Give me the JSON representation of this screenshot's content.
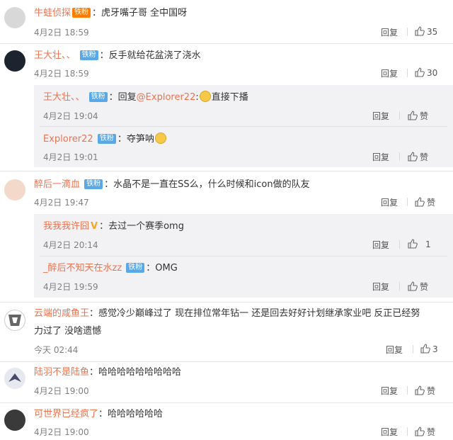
{
  "comments": [
    {
      "user": "牛蛙侦探",
      "badge": "铁粉",
      "text": "：虎牙嘴子哥  全中国呀",
      "time": "4月2日 18:59",
      "reply": "回复",
      "likes": "35"
    },
    {
      "user": "王大壮、、",
      "badge": "铁粉",
      "text": "：反手就给花盆浇了浇水",
      "time": "4月2日 18:59",
      "reply": "回复",
      "likes": "30",
      "replies": [
        {
          "user": "王大壮、、",
          "badge": "铁粉",
          "prefix": "：回复",
          "mention": "@Explorer22",
          "text": ":",
          "suffix": "直接下播",
          "time": "4月2日 19:04",
          "reply": "回复",
          "likes": "赞"
        },
        {
          "user": "Explorer22",
          "badge": "铁粉",
          "text": "：夺笋呐",
          "time": "4月2日 19:01",
          "reply": "回复",
          "likes": "赞"
        }
      ]
    },
    {
      "user": "醉后一滴血",
      "badge": "铁粉",
      "text": "：水晶不是一直在SS么，什么时候和icon做的队友",
      "time": "4月2日 19:47",
      "reply": "回复",
      "likes": "赞",
      "replies": [
        {
          "user": "我我我许囧",
          "text": "：去过一个赛季omg",
          "time": "4月2日 20:14",
          "reply": "回复",
          "likes": "1"
        },
        {
          "user": "_醉后不知天在水zz",
          "badge": "铁粉",
          "text": "：OMG",
          "time": "4月2日 19:59",
          "reply": "回复",
          "likes": "赞"
        }
      ]
    },
    {
      "user": "云端的咸鱼王",
      "text1": "：感觉冷少巅峰过了  现在排位常年钻一  还是回去好好计划继承家业吧  反正已经努",
      "text2": "力过了 没啥遗憾",
      "time": "今天 02:44",
      "reply": "回复",
      "likes": "3"
    },
    {
      "user": "陆羽不是陆鱼",
      "text": "：哈哈哈哈哈哈哈哈哈",
      "time": "4月2日 19:00",
      "reply": "回复",
      "likes": "赞"
    },
    {
      "user": "可世界已经疯了",
      "text": "：哈哈哈哈哈哈",
      "time": "4月2日 19:00",
      "reply": "回复",
      "likes": "赞"
    }
  ],
  "icons": {
    "like": "thumbs-up-icon",
    "emoji": "doge-emoji-icon",
    "verified": "v-verified-icon"
  },
  "colors": {
    "username": "#eb7350",
    "badge": "#5aa9e6",
    "reply_bg": "#f2f2f5"
  }
}
